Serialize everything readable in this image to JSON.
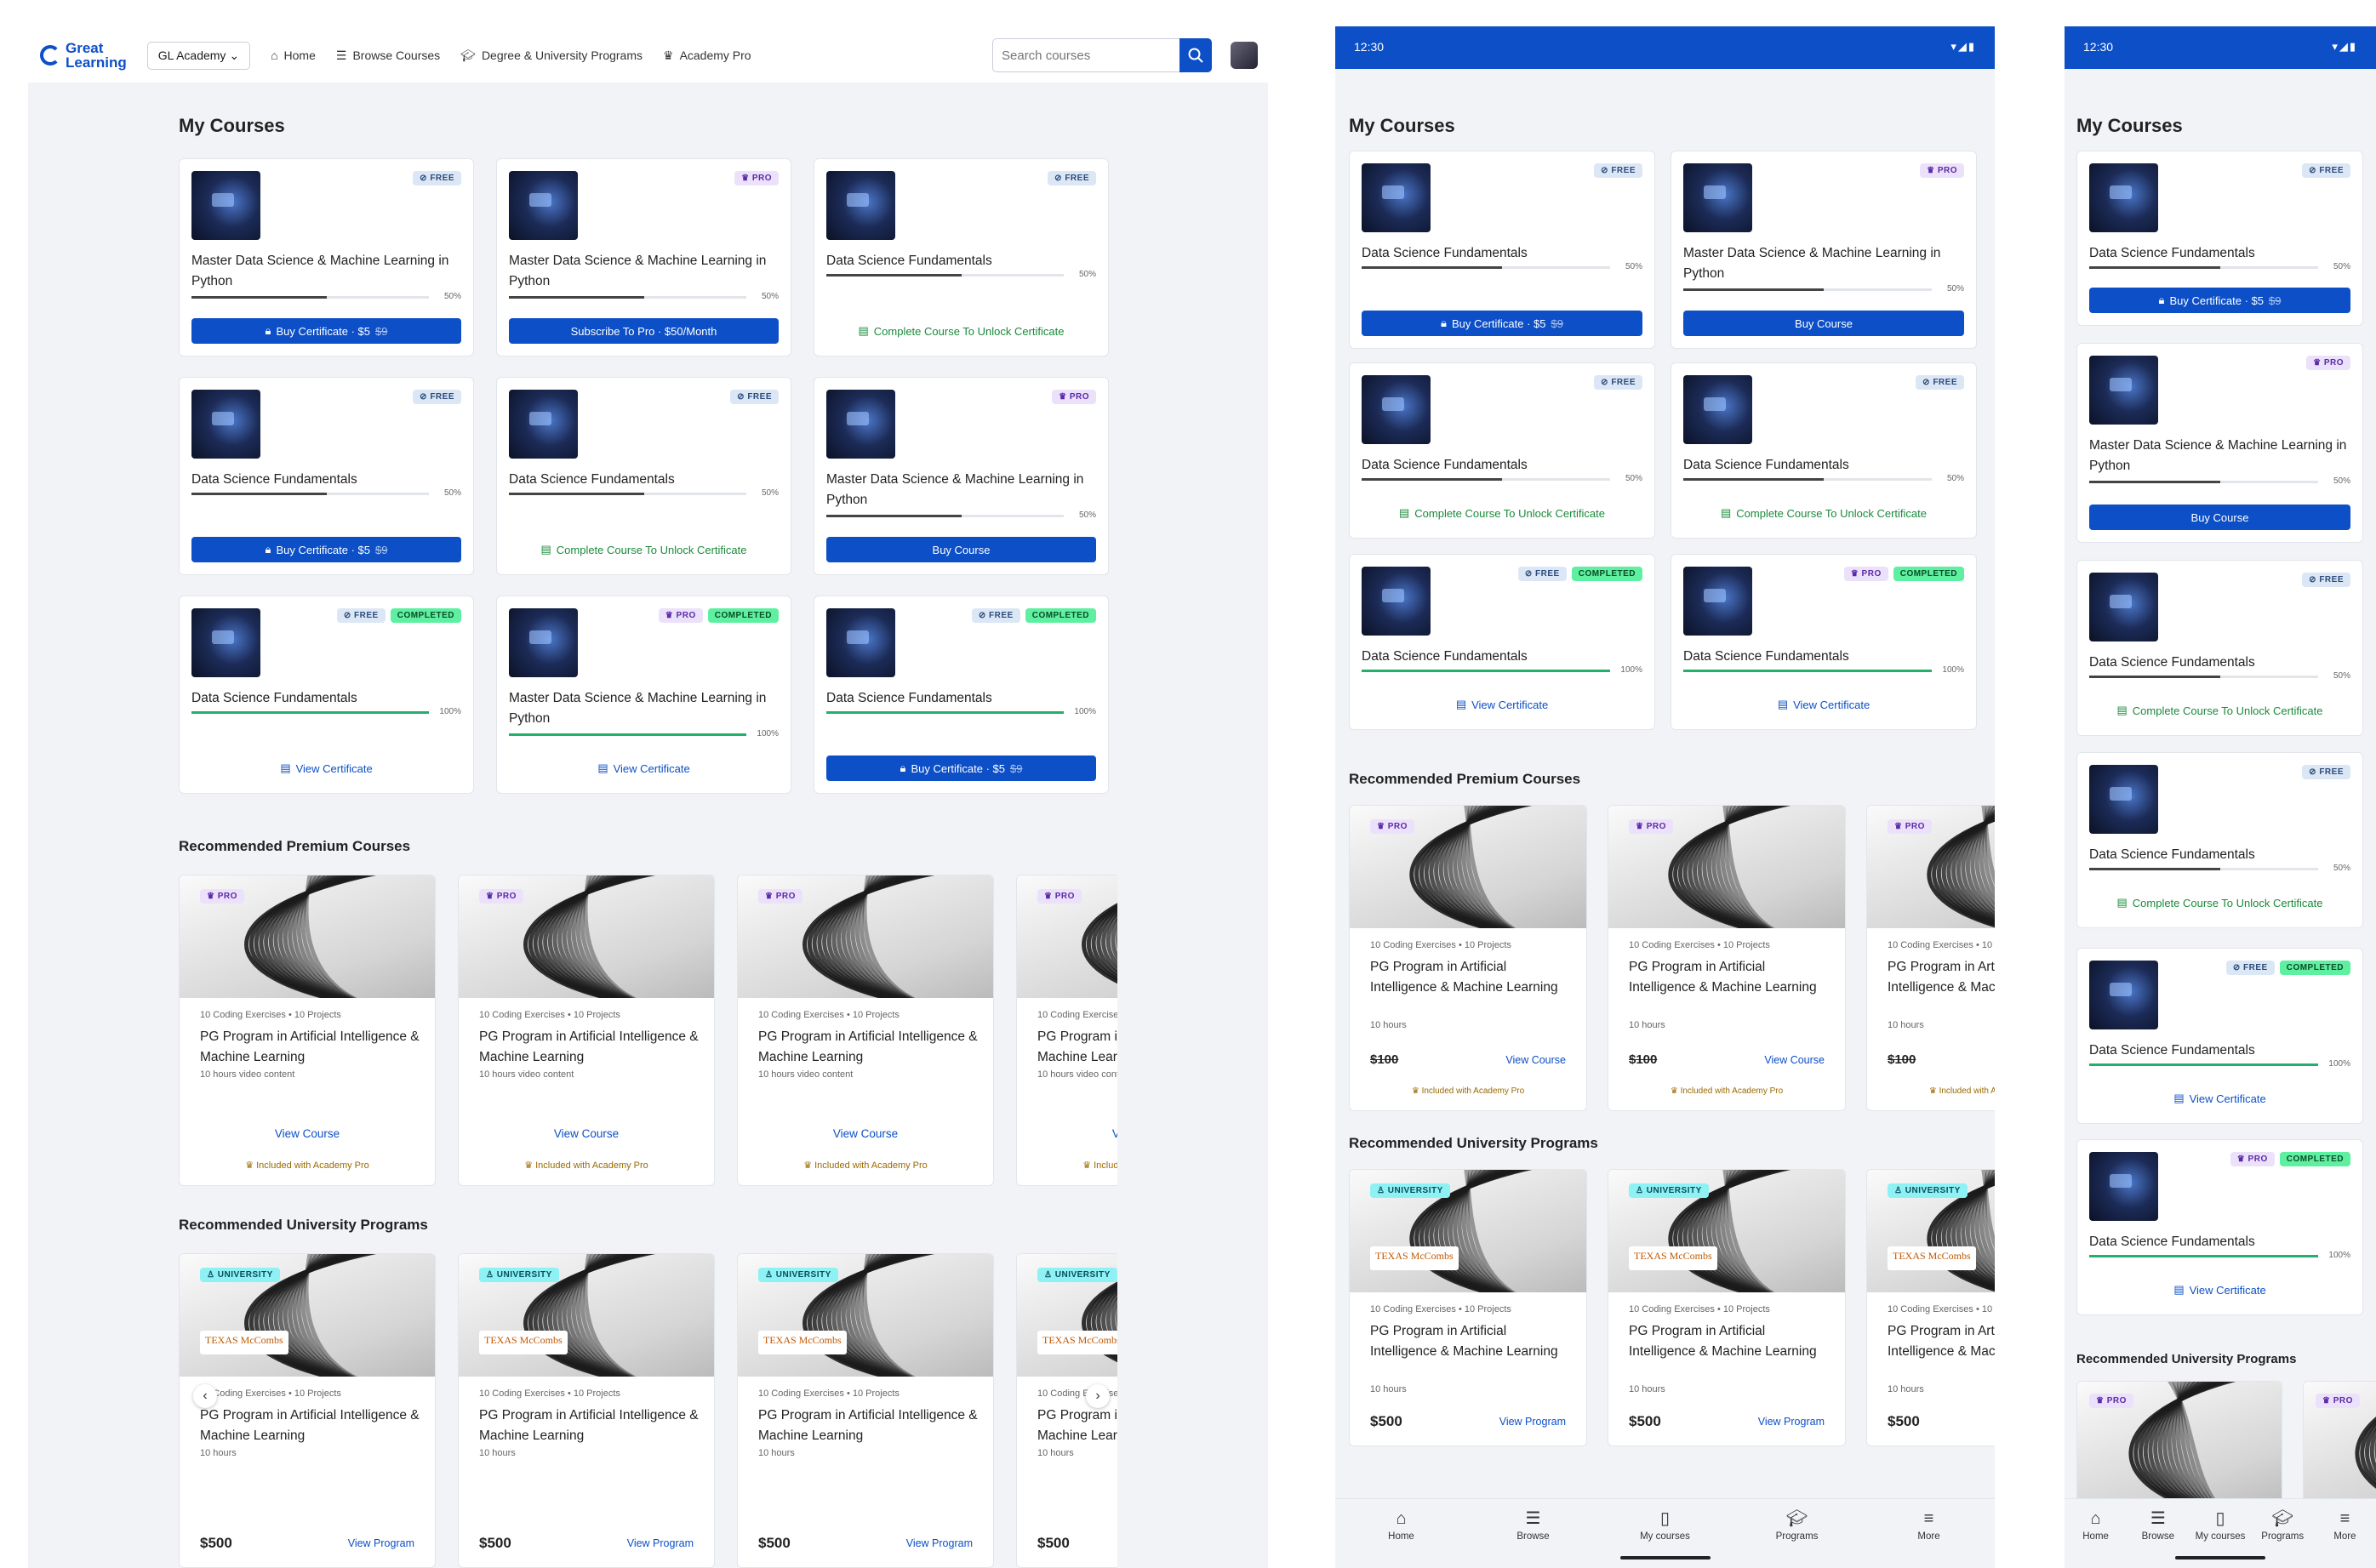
{
  "desktop": {
    "logo_line1": "Great",
    "logo_line2": "Learning",
    "academy": "GL Academy",
    "nav": [
      "Home",
      "Browse Courses",
      "Degree & University Programs",
      "Academy Pro"
    ],
    "search_placeholder": "Search courses",
    "my_courses_title": "My Courses",
    "premium_title": "Recommended Premium Courses",
    "university_title": "Recommended University Programs"
  },
  "labels": {
    "free": "FREE",
    "pro": "PRO",
    "completed": "COMPLETED",
    "university": "UNIVERSITY",
    "buy_cert": "Buy Certificate · $5",
    "old_price": "$9",
    "subscribe": "Subscribe To Pro · $50/Month",
    "unlock": "Complete Course To Unlock Certificate",
    "buy_course": "Buy Course",
    "view_cert": "View Certificate",
    "view_course": "View Course",
    "included": "Included with Academy Pro",
    "view_program": "View Program",
    "texas": "TEXAS McCombs"
  },
  "courses": [
    {
      "title": "Master Data Science & Machine Learning in Python",
      "badges": [
        "free"
      ],
      "progress": "50%",
      "action": "buy_cert"
    },
    {
      "title": "Master Data Science & Machine Learning in Python",
      "badges": [
        "pro"
      ],
      "progress": "50%",
      "action": "subscribe"
    },
    {
      "title": "Data Science Fundamentals",
      "badges": [
        "free"
      ],
      "progress": "50%",
      "action": "unlock"
    },
    {
      "title": "Data Science Fundamentals",
      "badges": [
        "free"
      ],
      "progress": "50%",
      "action": "buy_cert"
    },
    {
      "title": "Data Science Fundamentals",
      "badges": [
        "free"
      ],
      "progress": "50%",
      "action": "unlock"
    },
    {
      "title": "Master Data Science & Machine Learning in Python",
      "badges": [
        "pro"
      ],
      "progress": "50%",
      "action": "buy_course"
    },
    {
      "title": "Data Science Fundamentals",
      "badges": [
        "free",
        "completed"
      ],
      "progress": "100%",
      "action": "view_cert"
    },
    {
      "title": "Master Data Science & Machine Learning in Python",
      "badges": [
        "pro",
        "completed"
      ],
      "progress": "100%",
      "action": "view_cert"
    },
    {
      "title": "Data Science Fundamentals",
      "badges": [
        "free",
        "completed"
      ],
      "progress": "100%",
      "action": "buy_cert"
    }
  ],
  "premium": {
    "meta": "10 Coding Exercises • 10 Projects",
    "title": "PG Program in Artificial Intelligence & Machine Learning",
    "hours_video": "10 hours video content",
    "hours": "10 hours",
    "price_old": "$100",
    "price": "$500"
  },
  "tablet": {
    "time": "12:30",
    "my_courses_title": "My Courses",
    "premium_title": "Recommended Premium Courses",
    "university_title": "Recommended University Programs",
    "courses": [
      {
        "title": "Data Science Fundamentals",
        "badges": [
          "free"
        ],
        "progress": "50%",
        "action": "buy_cert"
      },
      {
        "title": "Master Data Science & Machine Learning in Python",
        "badges": [
          "pro"
        ],
        "progress": "50%",
        "action": "buy_course"
      },
      {
        "title": "Data Science Fundamentals",
        "badges": [
          "free"
        ],
        "progress": "50%",
        "action": "unlock"
      },
      {
        "title": "Data Science Fundamentals",
        "badges": [
          "free"
        ],
        "progress": "50%",
        "action": "unlock"
      },
      {
        "title": "Data Science Fundamentals",
        "badges": [
          "free",
          "completed"
        ],
        "progress": "100%",
        "action": "view_cert"
      },
      {
        "title": "Data Science Fundamentals",
        "badges": [
          "pro",
          "completed"
        ],
        "progress": "100%",
        "action": "view_cert"
      }
    ]
  },
  "phone": {
    "time": "12:30",
    "my_courses_title": "My Courses",
    "university_title": "Recommended University Programs",
    "courses": [
      {
        "title": "Data Science Fundamentals",
        "badges": [
          "free"
        ],
        "progress": "50%",
        "action": "buy_cert"
      },
      {
        "title": "Master Data Science & Machine Learning in Python",
        "badges": [
          "pro"
        ],
        "progress": "50%",
        "action": "buy_course"
      },
      {
        "title": "Data Science Fundamentals",
        "badges": [
          "free"
        ],
        "progress": "50%",
        "action": "unlock"
      },
      {
        "title": "Data Science Fundamentals",
        "badges": [
          "free"
        ],
        "progress": "50%",
        "action": "unlock"
      },
      {
        "title": "Data Science Fundamentals",
        "badges": [
          "free",
          "completed"
        ],
        "progress": "100%",
        "action": "view_cert"
      },
      {
        "title": "Data Science Fundamentals",
        "badges": [
          "pro",
          "completed"
        ],
        "progress": "100%",
        "action": "view_cert"
      }
    ]
  },
  "tabs": [
    "Home",
    "Browse",
    "My courses",
    "Programs",
    "More"
  ],
  "colors": {
    "primary": "#0c4fc7",
    "progress_done": "#22b06a",
    "free_badge": "#dce7f6",
    "pro_badge": "#ece1fb",
    "completed_badge": "#5ef0a0",
    "university_badge": "#8ef2f4"
  }
}
